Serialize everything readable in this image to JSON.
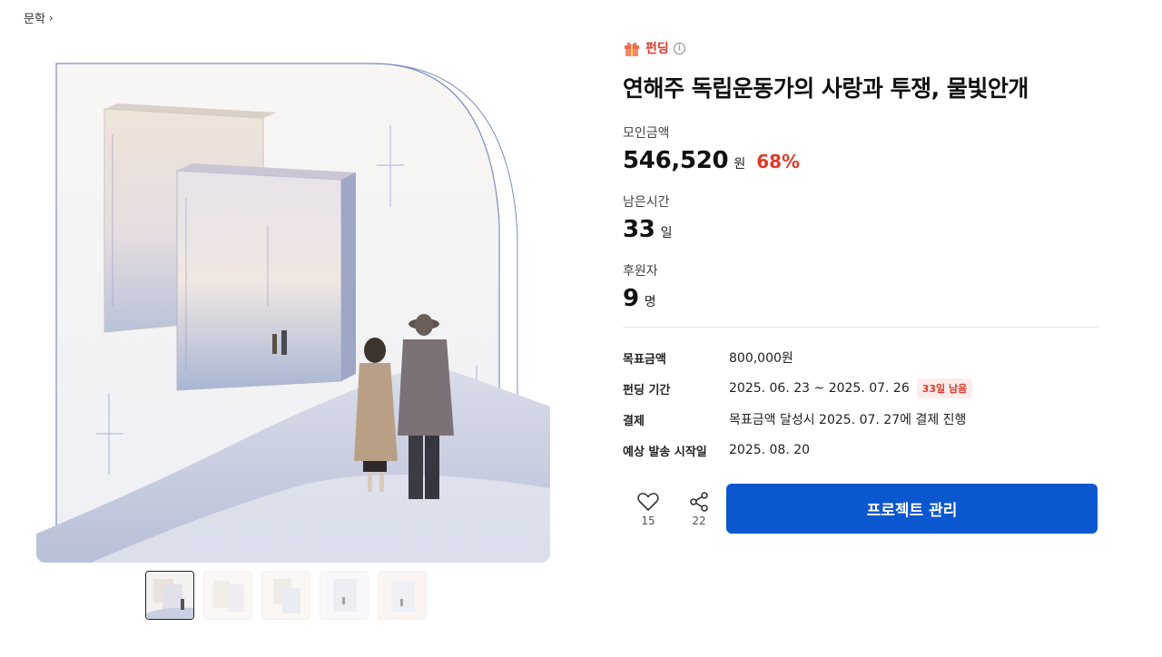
{
  "breadcrumb": {
    "category": "문학",
    "chevron": "›"
  },
  "gallery": {
    "main_image_alt": "book-cover-illustration",
    "thumbnail_count": 5
  },
  "product": {
    "badge": "펀딩",
    "badge_icon": "gift-icon",
    "info_icon": "i",
    "title": "연해주 독립운동가의 사랑과 투쟁, 물빛안개"
  },
  "stats": {
    "amount": {
      "label": "모인금액",
      "value": "546,520",
      "unit": "원",
      "rate": "68%"
    },
    "time": {
      "label": "남은시간",
      "value": "33",
      "unit": "일"
    },
    "backers": {
      "label": "후원자",
      "value": "9",
      "unit": "명"
    }
  },
  "details": [
    {
      "key": "목표금액",
      "value": "800,000원"
    },
    {
      "key": "펀딩 기간",
      "value": "2025. 06. 23 ~ 2025. 07. 26",
      "badge": "33일 남음"
    },
    {
      "key": "결제",
      "value": "목표금액 달성시 2025. 07. 27에 결제 진행"
    },
    {
      "key": "예상 발송 시작일",
      "value": "2025. 08. 20"
    }
  ],
  "actions": {
    "like_count": "15",
    "share_count": "22",
    "manage_label": "프로젝트 관리"
  },
  "colors": {
    "accent": "#0a57d0",
    "highlight": "#e0392b",
    "badge_bg": "#fdeceb"
  }
}
